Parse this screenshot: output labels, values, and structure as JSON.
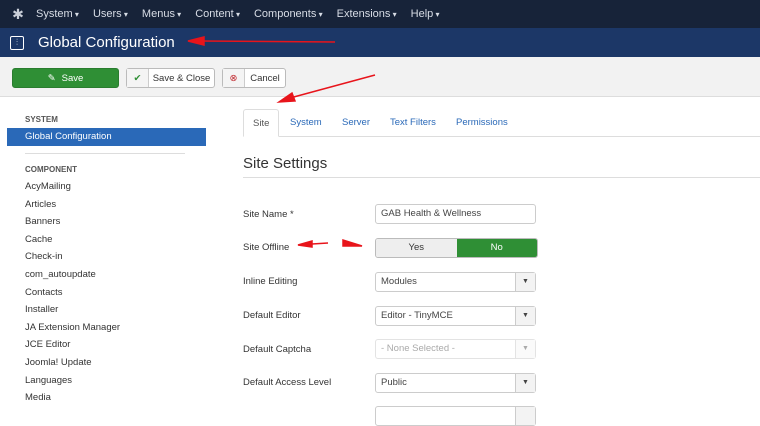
{
  "topnav": {
    "menus": [
      "System",
      "Users",
      "Menus",
      "Content",
      "Components",
      "Extensions",
      "Help"
    ]
  },
  "header": {
    "title": "Global Configuration"
  },
  "toolbar": {
    "save": "Save",
    "save_close": "Save & Close",
    "cancel": "Cancel"
  },
  "sidebar": {
    "system_heading": "SYSTEM",
    "active": "Global Configuration",
    "component_heading": "COMPONENT",
    "items": [
      "AcyMailing",
      "Articles",
      "Banners",
      "Cache",
      "Check-in",
      "com_autoupdate",
      "Contacts",
      "Installer",
      "JA Extension Manager",
      "JCE Editor",
      "Joomla! Update",
      "Languages",
      "Media"
    ]
  },
  "tabs": [
    "Site",
    "System",
    "Server",
    "Text Filters",
    "Permissions"
  ],
  "section_title": "Site Settings",
  "fields": {
    "site_name": {
      "label": "Site Name *",
      "value": "GAB Health & Wellness"
    },
    "site_offline": {
      "label": "Site Offline",
      "yes": "Yes",
      "no": "No",
      "selected": "No"
    },
    "inline_editing": {
      "label": "Inline Editing",
      "value": "Modules"
    },
    "default_editor": {
      "label": "Default Editor",
      "value": "Editor - TinyMCE"
    },
    "default_captcha": {
      "label": "Default Captcha",
      "value": "- None Selected -"
    },
    "default_access": {
      "label": "Default Access Level",
      "value": "Public"
    }
  },
  "colors": {
    "nav": "#172339",
    "header": "#1c3767",
    "accent": "#2a69b8",
    "success": "#2f8f35",
    "annotation": "#e8141b"
  }
}
